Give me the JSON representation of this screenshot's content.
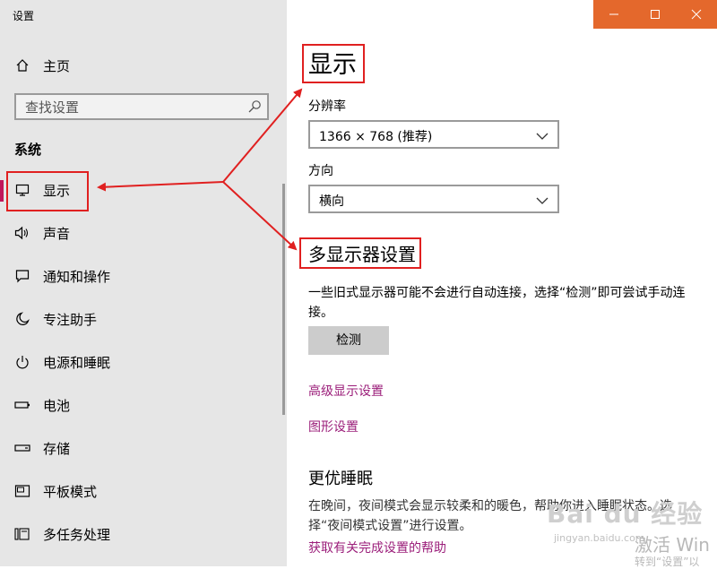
{
  "window": {
    "title": "设置"
  },
  "titlebar": {
    "accent": "#e4682c",
    "minimize_icon": "minimize-icon",
    "maximize_icon": "maximize-icon",
    "close_icon": "close-icon"
  },
  "sidebar": {
    "home_label": "主页",
    "search_placeholder": "查找设置",
    "section": "系统",
    "active_color": "#c0175a",
    "items": [
      {
        "label": "显示",
        "icon": "monitor-icon"
      },
      {
        "label": "声音",
        "icon": "speaker-icon"
      },
      {
        "label": "通知和操作",
        "icon": "message-icon"
      },
      {
        "label": "专注助手",
        "icon": "moon-icon"
      },
      {
        "label": "电源和睡眠",
        "icon": "power-icon"
      },
      {
        "label": "电池",
        "icon": "battery-icon"
      },
      {
        "label": "存储",
        "icon": "storage-icon"
      },
      {
        "label": "平板模式",
        "icon": "tablet-icon"
      },
      {
        "label": "多任务处理",
        "icon": "multitask-icon"
      }
    ]
  },
  "main": {
    "title": "显示",
    "resolution_label": "分辨率",
    "resolution_value": "1366 × 768 (推荐)",
    "orientation_label": "方向",
    "orientation_value": "横向",
    "multi_display_title": "多显示器设置",
    "multi_display_desc": "一些旧式显示器可能不会进行自动连接，选择“检测”即可尝试手动连接。",
    "detect_button": "检测",
    "advanced_link": "高级显示设置",
    "graphics_link": "图形设置",
    "sleep_title": "更优睡眠",
    "sleep_desc": "在晚间，夜间模式会显示较柔和的暖色，帮助你进入睡眠状态。选择“夜间模式设置”进行设置。",
    "help_link": "获取有关完成设置的帮助",
    "link_color": "#9b1e7a"
  },
  "annotation": {
    "color": "#e02020"
  },
  "watermark": {
    "brand": "Bai du 经验",
    "url": "jingyan.baidu.com",
    "activate": "激活 Win",
    "activate_sub": "转到“设置”以"
  }
}
